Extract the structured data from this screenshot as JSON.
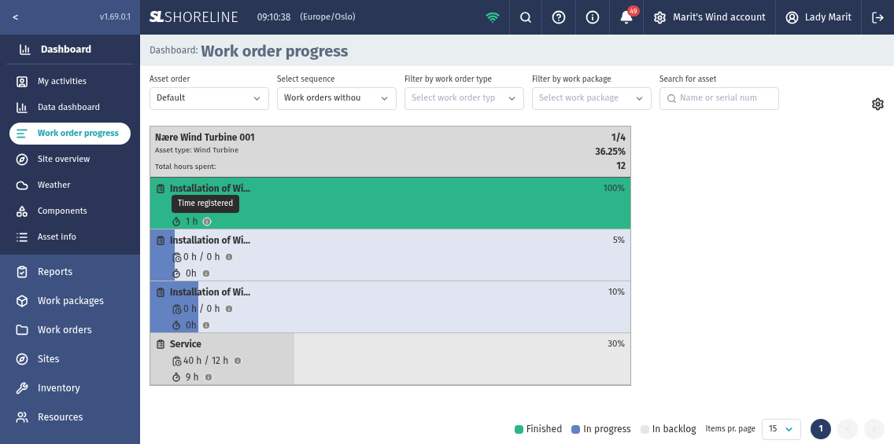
{
  "sidebar": {
    "collapse": "<",
    "version": "v1.69.0.1",
    "header": {
      "label": "Dashboard"
    },
    "groups": [
      {
        "items": [
          {
            "label": "My activities",
            "selected": false
          },
          {
            "label": "Data dashboard",
            "selected": false
          },
          {
            "label": "Work order progress",
            "selected": true
          },
          {
            "label": "Site overview",
            "selected": false
          },
          {
            "label": "Weather",
            "selected": false
          },
          {
            "label": "Components",
            "selected": false
          },
          {
            "label": "Asset info",
            "selected": false
          }
        ]
      },
      {
        "items": [
          {
            "label": "Reports",
            "selected": false
          },
          {
            "label": "Work packages",
            "selected": false
          },
          {
            "label": "Work orders",
            "selected": false
          },
          {
            "label": "Sites",
            "selected": false
          },
          {
            "label": "Inventory",
            "selected": false
          },
          {
            "label": "Resources",
            "selected": false
          }
        ]
      }
    ]
  },
  "topbar": {
    "brand_mark": "SL",
    "brand": "SHORELINE",
    "time": "09:10:38",
    "timezone": "(Europe/Oslo)",
    "notifications": "49",
    "account": "Marit's Wind account",
    "user": "Lady Marit"
  },
  "page": {
    "breadcrumb": "Dashboard:",
    "title": "Work order progress"
  },
  "filters": [
    {
      "label": "Asset order",
      "value": "Default",
      "kind": "select"
    },
    {
      "label": "Select sequence",
      "value": "Work orders withou",
      "kind": "select"
    },
    {
      "label": "Filter by work order type",
      "placeholder": "Select work order typ",
      "kind": "select"
    },
    {
      "label": "Filter by work package",
      "placeholder": "Select work package",
      "kind": "select"
    },
    {
      "label": "Search for asset",
      "placeholder": "Name or serial num",
      "kind": "search"
    }
  ],
  "asset": {
    "name": "Nære Wind Turbine 001",
    "type": "Asset type: Wind Turbine",
    "hours_label": "Total hours spent:",
    "count": "1/4",
    "percent": "36.25%",
    "hours": "12"
  },
  "work_orders": [
    {
      "title": "Installation of Wi…",
      "kind": "finished",
      "level": 1,
      "percent": "100%",
      "spent": "1 h",
      "tooltip": "Time registered"
    },
    {
      "title": "Installation of Wi…",
      "kind": "in_progress",
      "level": 0.05,
      "percent": "5%",
      "planned": "0 h / 0 h",
      "spent": "0h"
    },
    {
      "title": "Installation of Wi…",
      "kind": "in_progress",
      "level": 0.1,
      "percent": "10%",
      "planned": "0 h / 0 h",
      "spent": "0h"
    },
    {
      "title": "Service",
      "kind": "backlog",
      "level": 0.3,
      "percent": "30%",
      "planned": "40 h / 12 h",
      "spent": "9 h"
    }
  ],
  "legend": [
    {
      "label": "Finished",
      "color": "#2bb589"
    },
    {
      "label": "In progress",
      "color": "#6282c2"
    },
    {
      "label": "In backlog",
      "color": "#e6e6e6"
    }
  ],
  "pagination": {
    "items_label": "Items pr. page",
    "page_size": "15",
    "pages": [
      {
        "label": "1",
        "selected": true
      }
    ]
  }
}
